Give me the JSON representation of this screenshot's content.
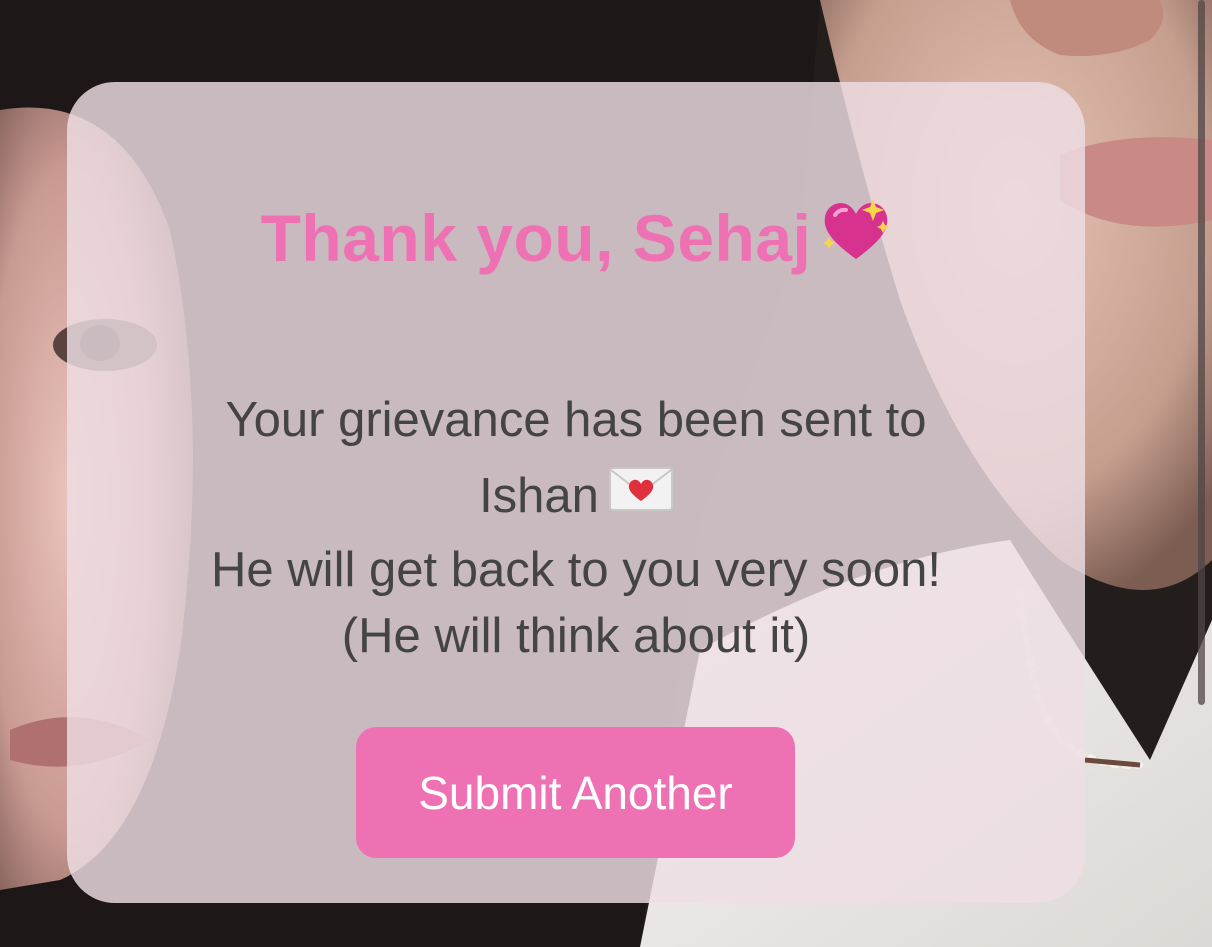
{
  "colors": {
    "accent_pink": "#ee72b3",
    "card_background": "#eedee4",
    "message_text": "#444444",
    "button_text": "#ffffff"
  },
  "card": {
    "title": "Thank you, Sehaj",
    "title_icon": "sparkling-heart-icon",
    "message": {
      "line1": "Your grievance has been sent to",
      "line2": "Ishan",
      "line2_icon": "love-letter-icon",
      "line3": "He will get back to you very soon!",
      "line4": "(He will think about it)"
    },
    "button_label": "Submit Another"
  }
}
